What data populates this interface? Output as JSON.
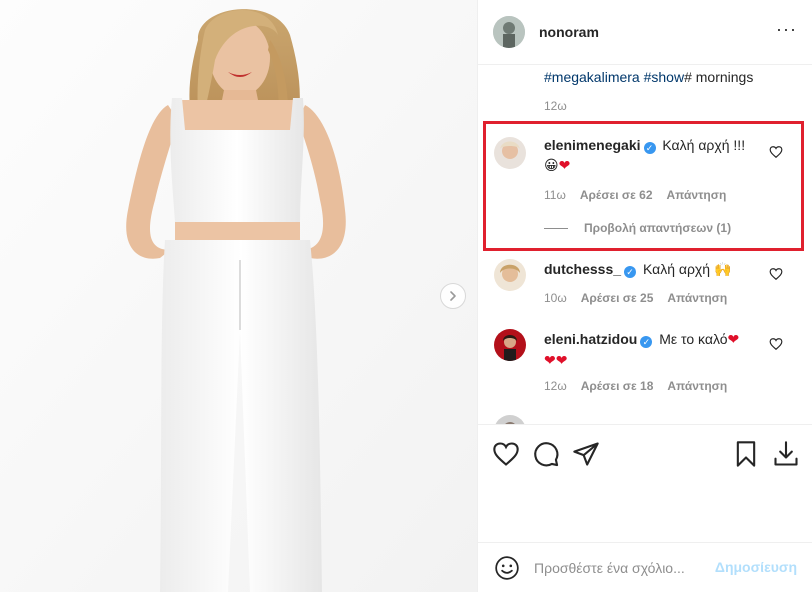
{
  "post": {
    "username": "nonoram",
    "more_label": "···",
    "photo_alt": "woman in white crop top and trousers",
    "next_icon": "chevron-right-icon"
  },
  "caption": {
    "hashtag1": "#megakalimera",
    "hashtag2": "#show",
    "rest": "# mornings",
    "time": "12ω"
  },
  "comments": [
    {
      "user": "elenimenegaki",
      "verified": true,
      "text": "Καλή αρχή !!!",
      "emoji": "😀",
      "heart": "❤",
      "time": "11ω",
      "likes": "Αρέσει σε 62",
      "reply": "Απάντηση",
      "view_replies": "Προβολή απαντήσεων (1)"
    },
    {
      "user": "dutchesss_",
      "verified": true,
      "text": "Καλή αρχή",
      "emoji": "🙌",
      "time": "10ω",
      "likes": "Αρέσει σε 25",
      "reply": "Απάντηση"
    },
    {
      "user": "eleni.hatzidou",
      "verified": true,
      "text": "Με το καλό",
      "heart": "❤",
      "hearts_line2": "❤❤",
      "time": "12ω",
      "likes": "Αρέσει σε 18",
      "reply": "Απάντηση"
    }
  ],
  "add_comment": {
    "placeholder": "Προσθέστε ένα σχόλιο...",
    "post_label": "Δημοσίευση"
  },
  "colors": {
    "highlight": "#e0202e",
    "verified": "#3897f0",
    "link": "#00376b",
    "post_disabled": "#b2dffc"
  }
}
